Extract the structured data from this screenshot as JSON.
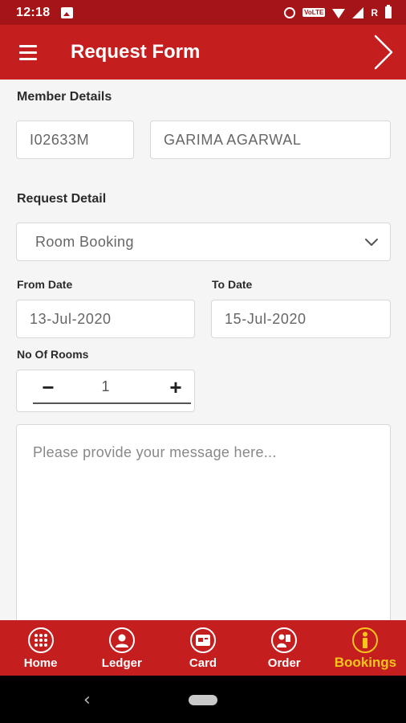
{
  "status_bar": {
    "time": "12:18",
    "carrier_badge": "VoLTE",
    "roaming": "R",
    "icons": [
      "image-icon",
      "alarm-icon",
      "volte-icon",
      "wifi-icon",
      "signal-icon",
      "battery-icon"
    ]
  },
  "app_bar": {
    "title": "Request Form",
    "menu_icon": "hamburger-menu-icon",
    "next_icon": "chevron-right-icon"
  },
  "member": {
    "section_label": "Member Details",
    "member_id": "I02633M",
    "member_name": "GARIMA AGARWAL"
  },
  "request": {
    "section_label": "Request Detail",
    "type_selected": "Room Booking",
    "from_label": "From Date",
    "from_value": "13-Jul-2020",
    "to_label": "To Date",
    "to_value": "15-Jul-2020",
    "rooms_label": "No Of Rooms",
    "rooms_minus": "−",
    "rooms_value": "1",
    "rooms_plus": "+",
    "message_placeholder": "Please provide your message here..."
  },
  "bottom_nav": {
    "items": [
      {
        "label": "Home",
        "icon": "grid-icon"
      },
      {
        "label": "Ledger",
        "icon": "user-icon"
      },
      {
        "label": "Card",
        "icon": "card-icon"
      },
      {
        "label": "Order",
        "icon": "order-icon"
      },
      {
        "label": "Bookings",
        "icon": "info-icon"
      }
    ],
    "active_index": 4,
    "active_color": "#f9c51b"
  },
  "system_nav": {
    "back_glyph": "‹"
  },
  "colors": {
    "status_bar": "#a51416",
    "brand_red": "#c41e1f",
    "background": "#f5f5f5"
  }
}
